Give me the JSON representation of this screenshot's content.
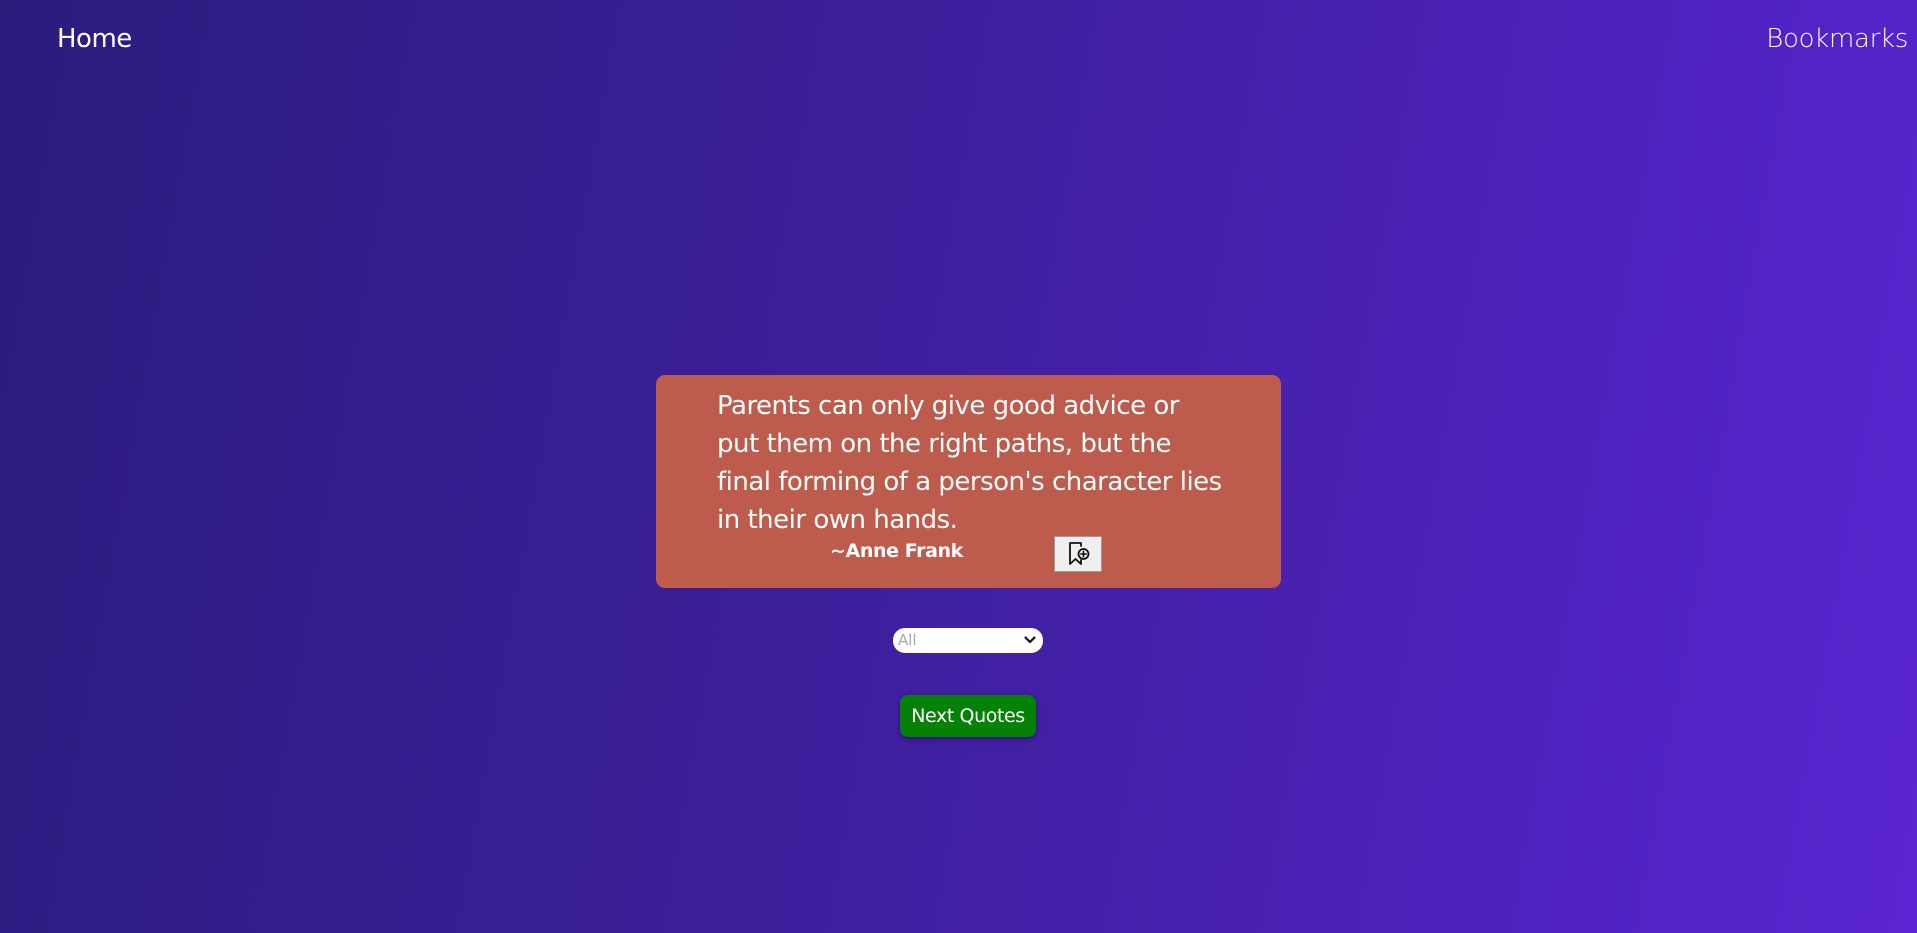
{
  "nav": {
    "home_label": "Home",
    "bookmarks_label": "Bookmarks"
  },
  "quote": {
    "text": "Parents can only give good advice or put them on the right paths, but the final forming of a person's character lies in their own hands.",
    "author": "~Anne Frank",
    "bookmark_icon": "bookmark-add-icon"
  },
  "filter": {
    "selected": "All"
  },
  "actions": {
    "next_label": "Next Quotes"
  },
  "colors": {
    "card_background": "#bd5c4c",
    "next_button": "#058105",
    "gradient_start": "#2c1c7e",
    "gradient_end": "#5a24d2"
  }
}
